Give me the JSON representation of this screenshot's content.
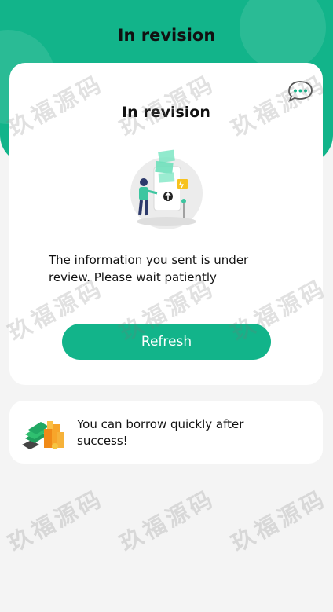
{
  "header": {
    "title": "In revision"
  },
  "status_card": {
    "title": "In revision",
    "chat_icon": "chat-bubble-icon",
    "illustration": "review-person-illustration",
    "message": "The information you sent is under review. Please wait patiently",
    "refresh_label": "Refresh"
  },
  "tip_card": {
    "illustration": "money-stack-illustration",
    "text": "You can borrow quickly after success!"
  },
  "watermark": {
    "text": "玖福源码"
  },
  "colors": {
    "accent": "#12b48a",
    "background": "#f4f4f4",
    "card": "#ffffff",
    "text": "#111111"
  }
}
